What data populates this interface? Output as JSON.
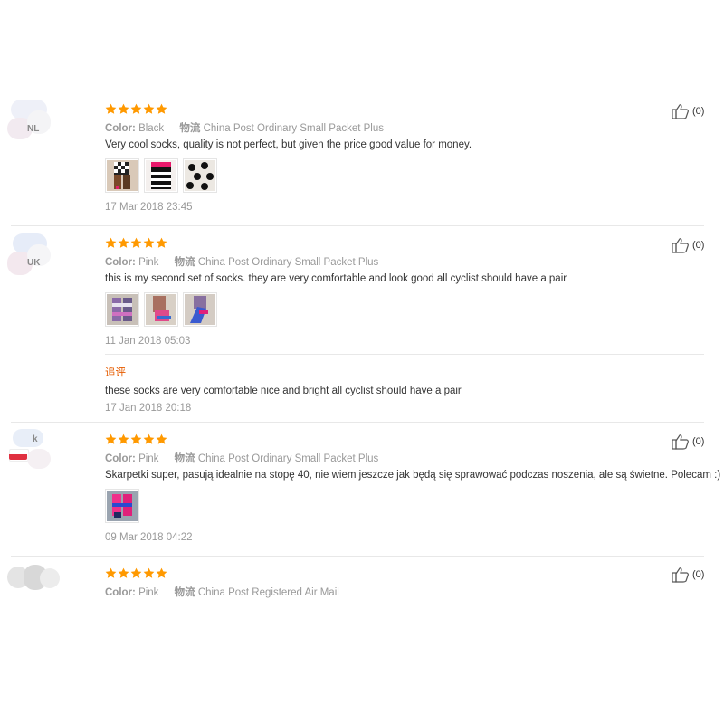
{
  "labels": {
    "color": "Color:",
    "shipping": "物流",
    "additional": "追评"
  },
  "colors": {
    "star": "#ff9900",
    "additional": "#e65c00"
  },
  "reviews": [
    {
      "country": "NL",
      "rating": 5,
      "color": "Black",
      "shipping": "China Post Ordinary Small Packet Plus",
      "text": "Very cool socks, quality is not perfect, but given the price good value for money.",
      "photos": [
        "sock-photo-checker",
        "sock-photo-stripes",
        "sock-photo-dots"
      ],
      "date": "17 Mar 2018 23:45",
      "helpful": "(0)"
    },
    {
      "country": "UK",
      "rating": 5,
      "color": "Pink",
      "shipping": "China Post Ordinary Small Packet Plus",
      "text": "this is my second set of socks. they are very comfortable and look good all cyclist should have a pair",
      "photos": [
        "sock-photo-pink-1",
        "sock-photo-pink-2",
        "sock-photo-pink-3"
      ],
      "date": "11 Jan 2018 05:03",
      "followup_text": "these socks are very comfortable nice and bright all cyclist should have a pair",
      "followup_date": "17 Jan 2018 20:18",
      "helpful": "(0)"
    },
    {
      "country": "k",
      "rating": 5,
      "color": "Pink",
      "shipping": "China Post Ordinary Small Packet Plus",
      "text": "Skarpetki super, pasują idealnie na stopę 40, nie wiem jeszcze jak będą się sprawować podczas noszenia, ale są świetne. Polecam :)",
      "photos": [
        "sock-photo-pink-pl"
      ],
      "date": "09 Mar 2018 04:22",
      "helpful": "(0)"
    },
    {
      "country": "",
      "rating": 5,
      "color": "Pink",
      "shipping": "China Post Registered Air Mail",
      "helpful": "(0)"
    }
  ]
}
